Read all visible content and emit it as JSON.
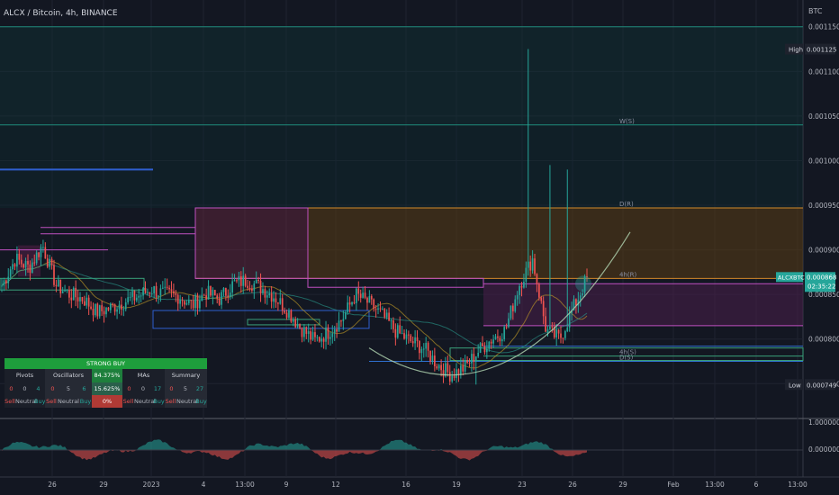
{
  "header": {
    "title": "ALCX / Bitcoin, 4h, BINANCE",
    "currency": "BTC"
  },
  "colors": {
    "bg": "#131722",
    "up": "#26a69a",
    "down": "#ef5350",
    "grid": "#1f2330",
    "axis_text": "#b2b5be"
  },
  "chart_data": {
    "type": "candlestick",
    "title": "ALCX / Bitcoin, 4h, BINANCE",
    "currency": "BTC",
    "y_ticks": [
      "0.001150",
      "0.001100",
      "0.001050",
      "0.001000",
      "0.000950",
      "0.000900",
      "0.000850",
      "0.000800",
      "0.000750"
    ],
    "ylim": [
      0.000714,
      0.00118
    ],
    "x_ticks": [
      "26",
      "29",
      "2023",
      "4",
      "13:00",
      "9",
      "12",
      "16",
      "19",
      "23",
      "26",
      "29",
      "Feb",
      "13:00",
      "6",
      "13:00"
    ],
    "price_tags": [
      {
        "label": "High",
        "value": "0.001125",
        "price": 0.001125
      },
      {
        "label": "ALCXBTC",
        "value": "0.000868",
        "time": "02:35:22",
        "price": 0.000868
      },
      {
        "label": "Low",
        "value": "0.000749",
        "price": 0.000749
      }
    ],
    "level_labels": [
      {
        "text": "W(S)",
        "price": 0.00104
      },
      {
        "text": "D(R)",
        "price": 0.000947
      },
      {
        "text": "4h(R)",
        "price": 0.000868
      },
      {
        "text": "4h(S)",
        "price": 0.000781
      },
      {
        "text": "D(S)",
        "price": 0.000775
      }
    ],
    "oscillator": {
      "ticks": [
        "1.000000",
        "0.000000"
      ]
    },
    "anchors": [
      [
        0.00086,
        0.00089,
        0.00088,
        0.000905,
        0.00086,
        0.00085,
        0.000845,
        0.00083,
        0.000835,
        0.000842,
        0.000848,
        0.000856,
        0.00085,
        0.000848,
        0.000838,
        0.000852,
        0.000845,
        0.000862,
        0.000866,
        0.000858,
        0.000848,
        0.000832,
        0.000812,
        0.000798,
        0.000808,
        0.000822,
        0.00085,
        0.00084,
        0.000826,
        0.000808,
        0.000798,
        0.00079,
        0.000772,
        0.00076,
        0.000768,
        0.000786,
        0.0008,
        0.00081,
        0.00086,
        0.00089,
        0.00081,
        0.0008,
        0.000835,
        0.000868
      ]
    ]
  },
  "pivot_table": {
    "title": "STRONG BUY",
    "groups": [
      {
        "name": "Pivots",
        "sell": "0",
        "neutral": "0",
        "buy": "4"
      },
      {
        "name": "Oscillators",
        "sell": "0",
        "neutral": "5",
        "buy": "6"
      },
      {
        "name": "MAs",
        "sell": "0",
        "neutral": "0",
        "buy": "17"
      },
      {
        "name": "Summary",
        "sell": "0",
        "neutral": "5",
        "buy": "27"
      }
    ],
    "pct_buy": "84.375%",
    "pct_neutral": "15.625%",
    "pct_sell": "0%",
    "labels": {
      "sell": "Sell",
      "neutral": "Neutral",
      "buy": "Buy"
    }
  }
}
